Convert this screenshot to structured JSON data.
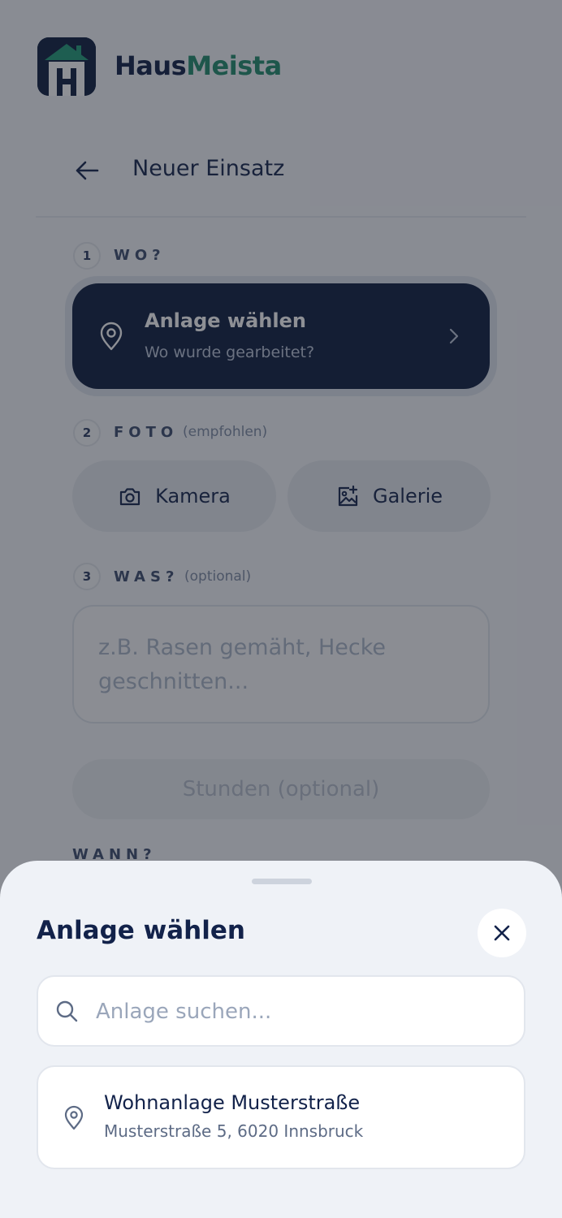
{
  "app": {
    "name_part1": "Haus",
    "name_part2": "Meista"
  },
  "header": {
    "title": "Neuer Einsatz"
  },
  "steps": {
    "wo": {
      "number": "1",
      "label": "WO?"
    },
    "foto": {
      "number": "2",
      "label": "FOTO",
      "hint": "(empfohlen)"
    },
    "was": {
      "number": "3",
      "label": "WAS?",
      "hint": "(optional)"
    },
    "wann": {
      "label": "WANN?"
    }
  },
  "anlage_card": {
    "title": "Anlage wählen",
    "subtitle": "Wo wurde gearbeitet?"
  },
  "photo_buttons": {
    "camera": "Kamera",
    "gallery": "Galerie"
  },
  "description": {
    "placeholder": "z.B. Rasen gemäht, Hecke geschnitten..."
  },
  "hours": {
    "label": "Stunden (optional)"
  },
  "sheet": {
    "title": "Anlage wählen",
    "search_placeholder": "Anlage suchen...",
    "results": [
      {
        "name": "Wohnanlage Musterstraße",
        "address": "Musterstraße 5, 6020 Innsbruck"
      }
    ]
  },
  "colors": {
    "brand_navy": "#0a1a3d",
    "brand_green": "#1f8a6b"
  }
}
